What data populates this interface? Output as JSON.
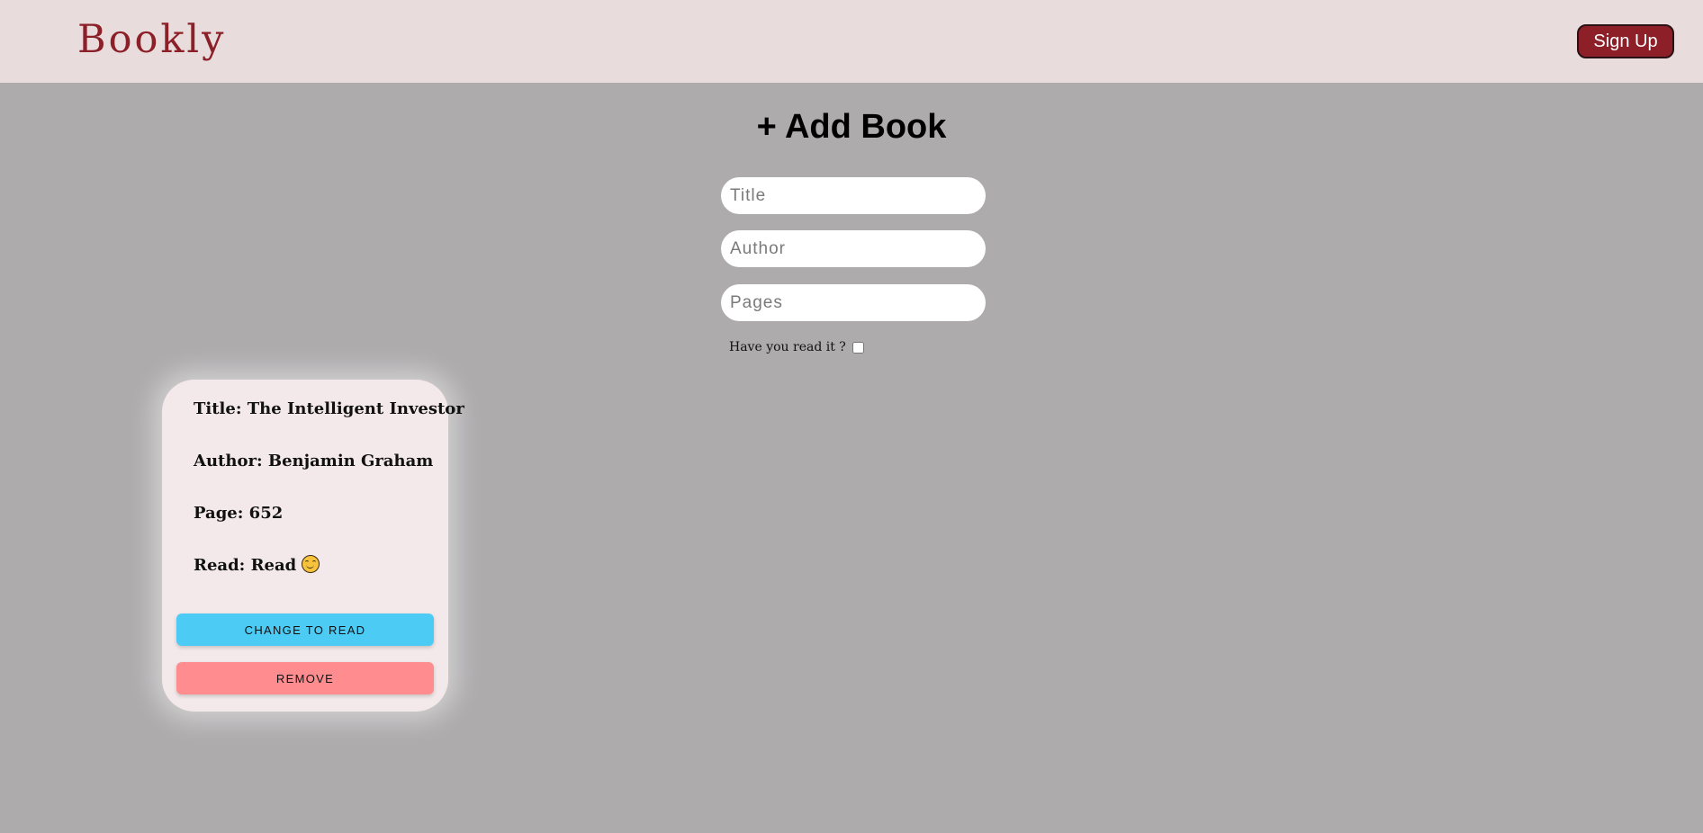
{
  "header": {
    "brand": "Bookly",
    "signup_label": "Sign Up"
  },
  "form": {
    "title": "+ Add Book",
    "title_placeholder": "Title",
    "author_placeholder": "Author",
    "pages_placeholder": "Pages",
    "read_question": "Have you read it ?",
    "read_checked": false
  },
  "books": [
    {
      "title_line": "Title: The Intelligent Investor",
      "author_line": "Author: Benjamin Graham",
      "page_line": "Page: 652",
      "read_line": "Read: Read",
      "read_icon": "smiling-face-icon",
      "change_label": "CHANGE TO READ",
      "remove_label": "REMOVE"
    }
  ],
  "colors": {
    "brand": "#8b2028",
    "header_bg": "#e8dcdd",
    "page_bg": "#adabac",
    "card_bg": "#f3e9ea",
    "change_button": "#4ccbf5",
    "remove_button": "#ff8c8f"
  }
}
